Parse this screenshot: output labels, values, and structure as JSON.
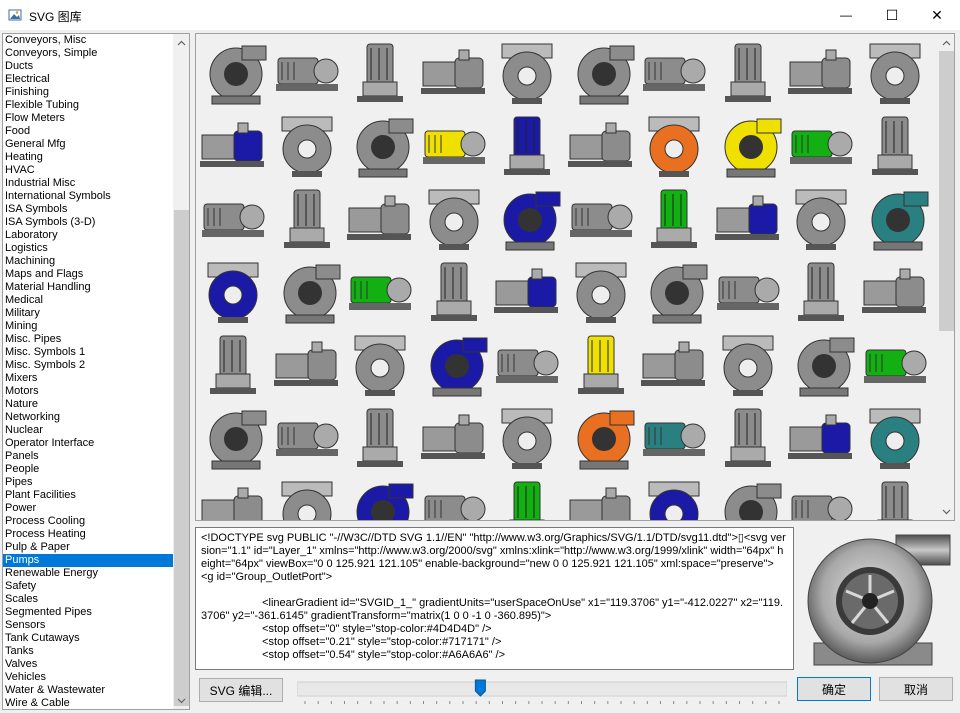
{
  "window": {
    "title": "SVG 图库",
    "minimize_glyph": "—",
    "maximize_glyph": "☐",
    "close_glyph": "✕"
  },
  "categories": [
    "Conveyors, Misc",
    "Conveyors, Simple",
    "Ducts",
    "Electrical",
    "Finishing",
    "Flexible Tubing",
    "Flow Meters",
    "Food",
    "General Mfg",
    "Heating",
    "HVAC",
    "Industrial Misc",
    "International Symbols",
    "ISA Symbols",
    "ISA Symbols (3-D)",
    "Laboratory",
    "Logistics",
    "Machining",
    "Maps and Flags",
    "Material Handling",
    "Medical",
    "Military",
    "Mining",
    "Misc. Pipes",
    "Misc. Symbols 1",
    "Misc. Symbols 2",
    "Mixers",
    "Motors",
    "Nature",
    "Networking",
    "Nuclear",
    "Operator Interface",
    "Panels",
    "People",
    "Pipes",
    "Plant Facilities",
    "Power",
    "Process Cooling",
    "Process Heating",
    "Pulp & Paper",
    "Pumps",
    "Renewable Energy",
    "Safety",
    "Scales",
    "Segmented Pipes",
    "Sensors",
    "Tank Cutaways",
    "Tanks",
    "Valves",
    "Vehicles",
    "Water & Wastewater",
    "Wire & Cable"
  ],
  "selected_category": "Pumps",
  "code_lines": [
    "<!DOCTYPE svg PUBLIC \"-//W3C//DTD SVG 1.1//EN\" \"http://www.w3.org/Graphics/SVG/1.1/DTD/svg11.dtd\">▯<svg version=\"1.1\" id=\"Layer_1\" xmlns=\"http://www.w3.org/2000/svg\" xmlns:xlink=\"http://www.w3.org/1999/xlink\" width=\"64px\" height=\"64px\" viewBox=\"0 0 125.921 121.105\" enable-background=\"new 0 0 125.921 121.105\" xml:space=\"preserve\">",
    "<g id=\"Group_OutletPort\">",
    "",
    "                    <linearGradient id=\"SVGID_1_\" gradientUnits=\"userSpaceOnUse\" x1=\"119.3706\" y1=\"-412.0227\" x2=\"119.3706\" y2=\"-361.6145\" gradientTransform=\"matrix(1 0 0 -1 0 -360.895)\">",
    "                    <stop offset=\"0\" style=\"stop-color:#4D4D4D\" />",
    "                    <stop offset=\"0.21\" style=\"stop-color:#717171\" />",
    "                    <stop offset=\"0.54\" style=\"stop-color:#A6A6A6\" />"
  ],
  "buttons": {
    "svg_edit": "SVG 编辑...",
    "ok": "确定",
    "cancel": "取消"
  },
  "slider": {
    "value": 0.37,
    "ticks": 37
  },
  "colors": {
    "selection": "#0078d7",
    "gray": "#8c8c8c",
    "blue": "#1a1aa6",
    "yellow": "#f0e000",
    "green": "#12b012",
    "orange": "#e87020",
    "teal": "#2a8080"
  },
  "pump_thumbnails": [
    "gray",
    "gray",
    "gray",
    "gray",
    "gray",
    "gray",
    "gray",
    "gray",
    "gray",
    "gray",
    "blue",
    "gray",
    "gray",
    "yellow",
    "blue",
    "gray",
    "orange",
    "yellow",
    "green",
    "gray",
    "gray",
    "gray",
    "gray",
    "gray",
    "blue",
    "gray",
    "green",
    "blue",
    "gray",
    "teal",
    "blue",
    "gray",
    "green",
    "gray",
    "blue",
    "gray",
    "gray",
    "gray",
    "gray",
    "gray",
    "gray",
    "gray",
    "gray",
    "blue",
    "gray",
    "yellow",
    "gray",
    "gray",
    "gray",
    "green",
    "gray",
    "gray",
    "gray",
    "gray",
    "gray",
    "orange",
    "teal",
    "gray",
    "blue",
    "teal",
    "gray",
    "gray",
    "blue",
    "gray",
    "green",
    "gray",
    "blue",
    "gray",
    "gray",
    "gray"
  ]
}
